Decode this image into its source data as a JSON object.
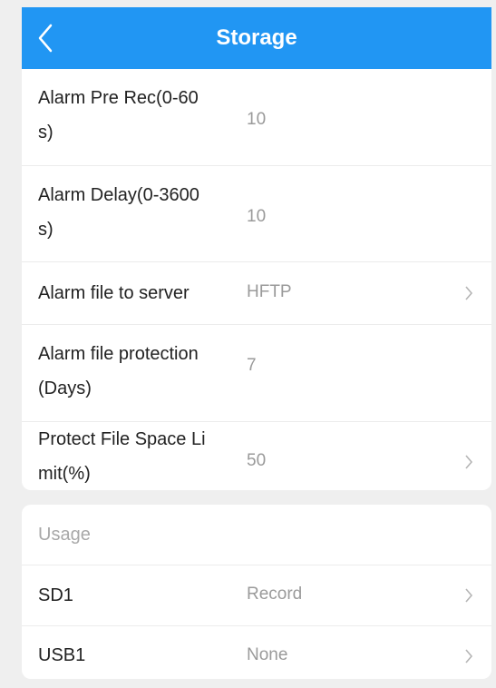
{
  "header": {
    "title": "Storage"
  },
  "settings": [
    {
      "label_line1": "Alarm Pre Rec(0-60",
      "label_line2": "s)",
      "value": "10"
    },
    {
      "label_line1": "Alarm Delay(0-3600",
      "label_line2": "s)",
      "value": "10"
    },
    {
      "label": "Alarm file to server",
      "value": "HFTP"
    },
    {
      "label_line1": "Alarm file protection",
      "label_line2": "(Days)",
      "value": "7"
    },
    {
      "label_line1": "Protect File Space Li",
      "label_line2": "mit(%)",
      "value": "50"
    }
  ],
  "usage": {
    "title": "Usage",
    "items": [
      {
        "label": "SD1",
        "value": "Record"
      },
      {
        "label": "USB1",
        "value": "None"
      }
    ]
  },
  "colors": {
    "header": "#2196f3",
    "background": "#efefef",
    "value_text": "#9a9a9a"
  },
  "icons": {
    "back": "chevron-left-icon",
    "row_arrow": "chevron-right-icon"
  }
}
